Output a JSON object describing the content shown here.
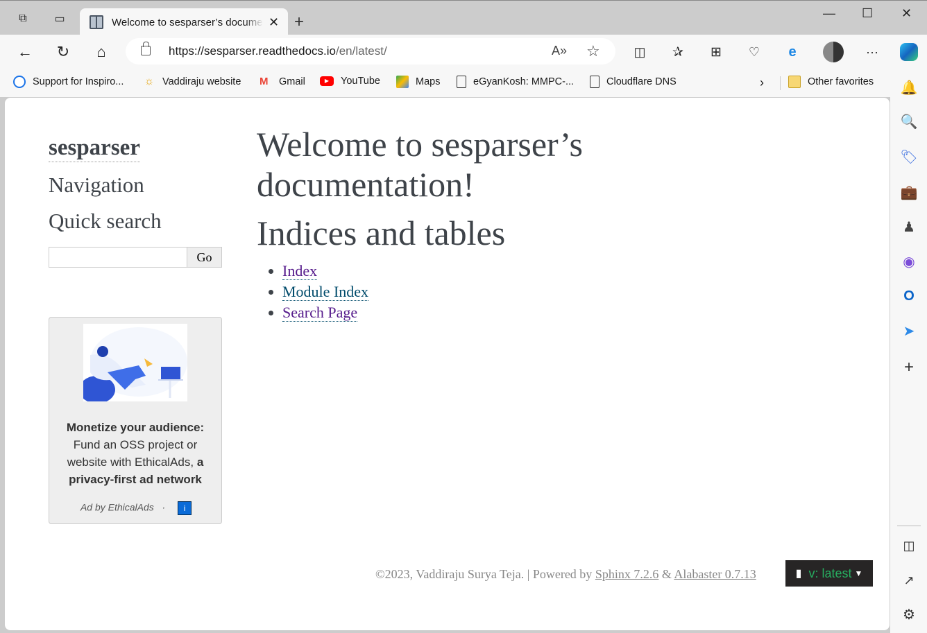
{
  "browser": {
    "tab_title": "Welcome to sesparser’s documentation!",
    "new_tab_label": "+",
    "url_host": "https://sesparser.readthedocs.io",
    "url_path": "/en/latest/",
    "bookmarks": [
      {
        "label": "Support for Inspiro...",
        "icon": "dell-icon"
      },
      {
        "label": "Vaddiraju website",
        "icon": "sun-icon"
      },
      {
        "label": "Gmail",
        "icon": "gmail-icon"
      },
      {
        "label": "YouTube",
        "icon": "youtube-icon"
      },
      {
        "label": "Maps",
        "icon": "maps-icon"
      },
      {
        "label": "eGyanKosh: MMPC-...",
        "icon": "page-icon"
      },
      {
        "label": "Cloudflare DNS",
        "icon": "page-icon"
      }
    ],
    "other_favorites": "Other favorites"
  },
  "sidebar": {
    "project": "sesparser",
    "navigation_heading": "Navigation",
    "quick_search_heading": "Quick search",
    "search_value": "",
    "go_label": "Go"
  },
  "ad": {
    "headline": "Monetize your audience:",
    "body": "Fund an OSS project or website with EthicalAds,",
    "bold_tail": "a privacy-first ad network",
    "by": "Ad by EthicalAds",
    "sep": "·",
    "info": "i"
  },
  "main": {
    "title": "Welcome to sesparser’s documentation!",
    "section": "Indices and tables",
    "links": [
      {
        "label": "Index",
        "color": "#551a8b"
      },
      {
        "label": "Module Index",
        "color": "#004b6b"
      },
      {
        "label": "Search Page",
        "color": "#551a8b"
      }
    ]
  },
  "footer": {
    "copyright": "©2023, Vaddiraju Surya Teja. | Powered by ",
    "sphinx": "Sphinx 7.2.6",
    "amp": " & ",
    "alabaster": "Alabaster 0.7.13"
  },
  "rtd": {
    "version": "v: latest"
  }
}
